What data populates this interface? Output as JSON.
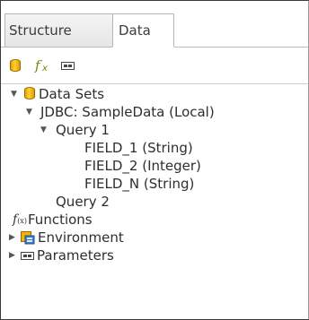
{
  "tabs": [
    {
      "label": "Structure"
    },
    {
      "label": "Data"
    }
  ],
  "toolbar": {
    "buttons": [
      {
        "icon": "database-icon"
      },
      {
        "icon": "function-icon"
      },
      {
        "icon": "parameter-icon"
      }
    ]
  },
  "tree": {
    "data_sets": "Data Sets",
    "jdbc": "JDBC: SampleData (Local)",
    "query1": "Query 1",
    "field1": "FIELD_1 (String)",
    "field2": "FIELD_2 (Integer)",
    "fieldn": "FIELD_N (String)",
    "query2": "Query 2",
    "functions": "Functions",
    "environment": "Environment",
    "parameters": "Parameters"
  },
  "colors": {
    "database": "#f2b400",
    "function": "#6a8f00",
    "border": "#3a3a3a"
  }
}
